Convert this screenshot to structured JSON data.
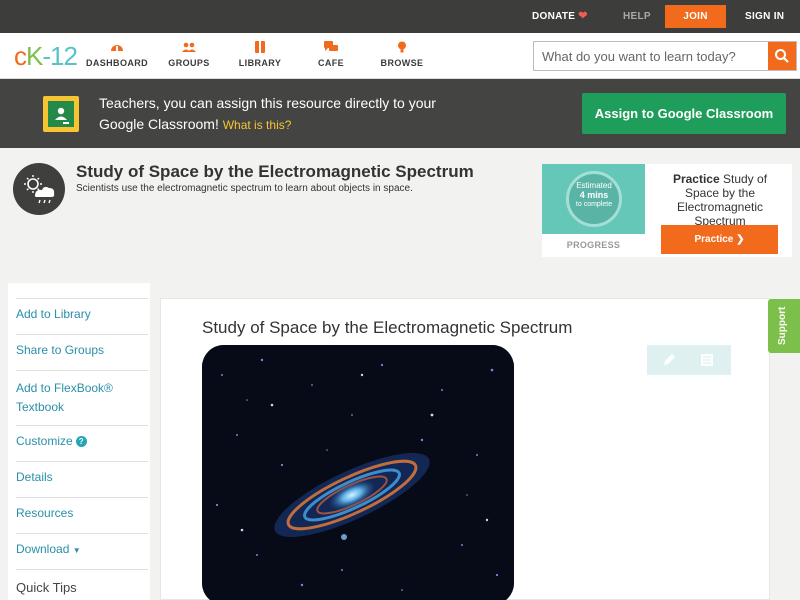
{
  "topbar": {
    "donate": "DONATE",
    "help": "HELP",
    "join": "JOIN",
    "signin": "SIGN IN"
  },
  "logo": {
    "c": "c",
    "k": "K",
    "n": "-12"
  },
  "nav": {
    "items": [
      {
        "label": "DASHBOARD",
        "icon": "dashboard-icon"
      },
      {
        "label": "GROUPS",
        "icon": "groups-icon"
      },
      {
        "label": "LIBRARY",
        "icon": "library-icon"
      },
      {
        "label": "CAFE",
        "icon": "cafe-icon"
      },
      {
        "label": "BROWSE",
        "icon": "browse-icon"
      }
    ],
    "search_placeholder": "What do you want to learn today?"
  },
  "banner": {
    "text": "Teachers, you can assign this resource directly to your Google Classroom!",
    "what": "What is this?",
    "button": "Assign to Google Classroom"
  },
  "topic": {
    "title": "Study of Space by the Electromagnetic Spectrum",
    "subtitle": "Scientists use the electromagnetic spectrum to learn about objects in space."
  },
  "practice": {
    "estimated": "Estimated",
    "mins": "4 mins",
    "complete": "to complete",
    "progress": "PROGRESS",
    "title_bold": "Practice",
    "title_rest": "Study of Space by the Electromagnetic",
    "button": "Practice"
  },
  "sidebar": {
    "items": [
      "Add to Library",
      "Share to Groups",
      "Add to FlexBook®",
      "Textbook",
      "Customize",
      "Details",
      "Resources",
      "Download"
    ],
    "quick_tips": "Quick Tips"
  },
  "content": {
    "title": "Study of Space by the Electromagnetic Spectrum"
  },
  "support": "Support",
  "colors": {
    "accent_orange": "#f26b1d",
    "brand_green": "#1e9e5a",
    "link_teal": "#2a8fa8"
  }
}
